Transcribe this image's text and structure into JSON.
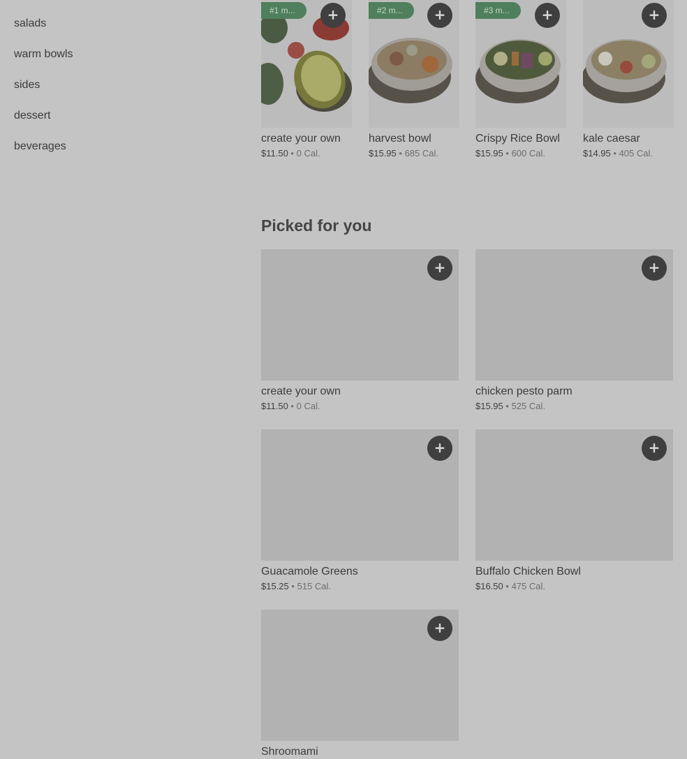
{
  "sidebar": {
    "items": [
      {
        "label": "salads"
      },
      {
        "label": "warm bowls"
      },
      {
        "label": "sides"
      },
      {
        "label": "dessert"
      },
      {
        "label": "beverages"
      }
    ]
  },
  "top_items": [
    {
      "rank": "#1 m...",
      "name": "create your own",
      "price": "$11.50",
      "sep": "•",
      "cal": "0 Cal."
    },
    {
      "rank": "#2 m...",
      "name": "harvest bowl",
      "price": "$15.95",
      "sep": "•",
      "cal": "685 Cal."
    },
    {
      "rank": "#3 m...",
      "name": "Crispy Rice Bowl",
      "price": "$15.95",
      "sep": "•",
      "cal": "600 Cal."
    },
    {
      "rank": "",
      "name": "kale caesar",
      "price": "$14.95",
      "sep": "•",
      "cal": "405 Cal."
    }
  ],
  "picked": {
    "title": "Picked for you",
    "items": [
      {
        "name": "create your own",
        "price": "$11.50",
        "sep": "•",
        "cal": "0 Cal."
      },
      {
        "name": "chicken pesto parm",
        "price": "$15.95",
        "sep": "•",
        "cal": "525 Cal."
      },
      {
        "name": "Guacamole Greens",
        "price": "$15.25",
        "sep": "•",
        "cal": "515 Cal."
      },
      {
        "name": "Buffalo Chicken Bowl",
        "price": "$16.50",
        "sep": "•",
        "cal": "475 Cal."
      },
      {
        "name": "Shroomami",
        "price": "",
        "sep": "",
        "cal": ""
      }
    ]
  },
  "icons": {
    "add": "plus-icon"
  },
  "colors": {
    "background": "#c4c4c4",
    "rank_badge": "#4f7f5c",
    "add_button": "#3f3f3f",
    "image_placeholder": "#b2b2b2"
  }
}
